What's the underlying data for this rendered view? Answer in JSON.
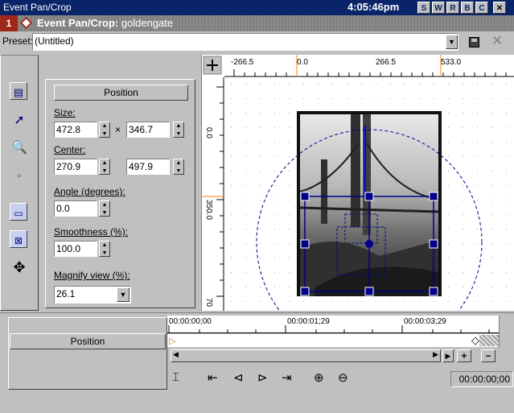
{
  "window": {
    "title": "Event Pan/Crop",
    "clock": "4:05:46pm",
    "title_buttons": [
      "S",
      "W",
      "R",
      "B",
      "C"
    ],
    "close_glyph": "✕"
  },
  "header": {
    "number": "1",
    "label_bold": "Event Pan/Crop:",
    "label_name": " goldengate"
  },
  "preset": {
    "label": "Preset:",
    "value": "(Untitled)"
  },
  "panel": {
    "section_title": "Position",
    "size_label": "Size:",
    "size_w": "472.8",
    "size_x": "×",
    "size_h": "346.7",
    "center_label": "Center:",
    "center_x": "270.9",
    "center_y": "497.9",
    "angle_label": "Angle (degrees):",
    "angle": "0.0",
    "smooth_label": "Smoothness (%):",
    "smooth": "100.0",
    "magnify_label": "Magnify view (%):",
    "magnify": "26.1"
  },
  "ruler": {
    "top": [
      "-266.5",
      "0.0",
      "266.5",
      "533.0"
    ],
    "left": [
      "0.0",
      "350.0",
      "70"
    ]
  },
  "timeline": {
    "track_label": "Position",
    "times": [
      "00:00:00;00",
      "00:00:01;29",
      "00:00:03;29"
    ],
    "time_display": "00:00:00;00",
    "plus": "+",
    "minus": "−"
  },
  "tool_icons": [
    "properties-icon",
    "pointer-icon",
    "zoom-icon",
    "normal-edit-icon",
    "source-aspect-icon",
    "fit-icon",
    "move-icon"
  ],
  "colors": {
    "titlebar": "#0a246a",
    "accent_red": "#a0281a",
    "handle_blue": "#000080",
    "selection_blue": "#00008b"
  }
}
